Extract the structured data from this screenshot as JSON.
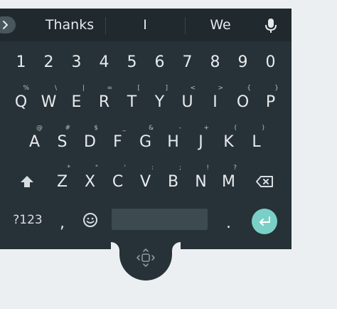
{
  "suggestions": {
    "items": [
      "Thanks",
      "I",
      "We"
    ]
  },
  "keyboard": {
    "numbers": [
      "1",
      "2",
      "3",
      "4",
      "5",
      "6",
      "7",
      "8",
      "9",
      "0"
    ],
    "row1": [
      {
        "key": "Q",
        "hint": "%"
      },
      {
        "key": "W",
        "hint": "\\"
      },
      {
        "key": "E",
        "hint": "|"
      },
      {
        "key": "R",
        "hint": "="
      },
      {
        "key": "T",
        "hint": "["
      },
      {
        "key": "Y",
        "hint": "]"
      },
      {
        "key": "U",
        "hint": "<"
      },
      {
        "key": "I",
        "hint": ">"
      },
      {
        "key": "O",
        "hint": "{"
      },
      {
        "key": "P",
        "hint": "}"
      }
    ],
    "row2": [
      {
        "key": "A",
        "hint": "@"
      },
      {
        "key": "S",
        "hint": "#"
      },
      {
        "key": "D",
        "hint": "$"
      },
      {
        "key": "F",
        "hint": "_"
      },
      {
        "key": "G",
        "hint": "&"
      },
      {
        "key": "H",
        "hint": "-"
      },
      {
        "key": "J",
        "hint": "+"
      },
      {
        "key": "K",
        "hint": "("
      },
      {
        "key": "L",
        "hint": ")"
      }
    ],
    "row3": [
      {
        "key": "Z",
        "hint": "*"
      },
      {
        "key": "X",
        "hint": "\""
      },
      {
        "key": "C",
        "hint": "'"
      },
      {
        "key": "V",
        "hint": ":"
      },
      {
        "key": "B",
        "hint": ";"
      },
      {
        "key": "N",
        "hint": "!"
      },
      {
        "key": "M",
        "hint": "?"
      }
    ],
    "symbols_label": "?123",
    "comma": ",",
    "period": "."
  },
  "colors": {
    "keyboard_bg": "#263238",
    "suggestion_bg": "#1f292e",
    "enter_accent": "#7ad0c6",
    "page_bg": "#eceff2"
  },
  "icons": [
    "chevron-right-icon",
    "microphone-icon",
    "shift-icon",
    "backspace-icon",
    "emoji-icon",
    "enter-icon",
    "move-handle-icon"
  ]
}
